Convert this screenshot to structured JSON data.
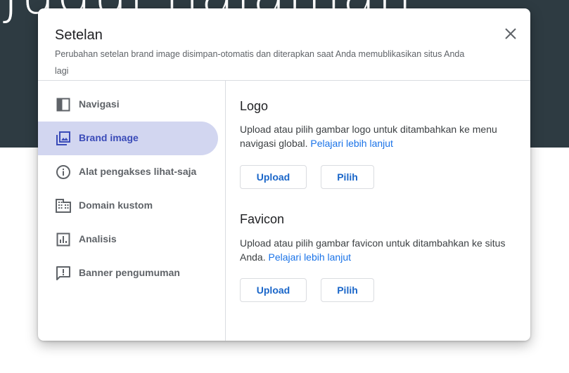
{
  "backdrop": {
    "title_text": "Judul halaman"
  },
  "dialog": {
    "title": "Setelan",
    "subtitle": "Perubahan setelan brand image disimpan-otomatis dan diterapkan saat Anda memublikasikan situs Anda lagi",
    "close_icon": "close-icon"
  },
  "sidebar": {
    "items": [
      {
        "label": "Navigasi",
        "icon": "navigation-icon",
        "active": false
      },
      {
        "label": "Brand image",
        "icon": "brand-image-icon",
        "active": true
      },
      {
        "label": "Alat pengakses lihat-saja",
        "icon": "info-icon",
        "active": false
      },
      {
        "label": "Domain kustom",
        "icon": "domain-icon",
        "active": false
      },
      {
        "label": "Analisis",
        "icon": "analytics-icon",
        "active": false
      },
      {
        "label": "Banner pengumuman",
        "icon": "announcement-icon",
        "active": false
      }
    ]
  },
  "sections": {
    "logo": {
      "title": "Logo",
      "description": "Upload atau pilih gambar logo untuk ditambahkan ke menu navigasi global.",
      "link": "Pelajari lebih lanjut",
      "upload_label": "Upload",
      "pick_label": "Pilih"
    },
    "favicon": {
      "title": "Favicon",
      "description": "Upload atau pilih gambar favicon untuk ditambahkan ke situs Anda.",
      "link": "Pelajari lebih lanjut",
      "upload_label": "Upload",
      "pick_label": "Pilih"
    }
  },
  "colors": {
    "accent": "#1a73e8",
    "active_nav_bg": "#d2d6f0",
    "active_nav_text": "#3a4bb8",
    "backdrop": "#2e3b42"
  }
}
